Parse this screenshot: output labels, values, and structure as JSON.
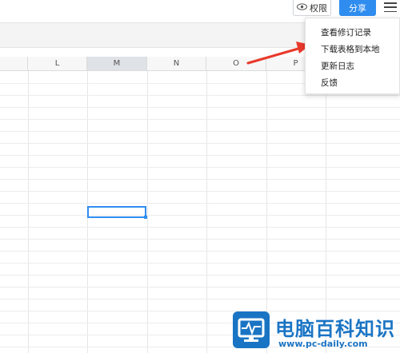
{
  "header": {
    "permissions_label": "权限",
    "share_label": "分享"
  },
  "columns": [
    {
      "label": "L",
      "selected": false
    },
    {
      "label": "M",
      "selected": true
    },
    {
      "label": "N",
      "selected": false
    },
    {
      "label": "O",
      "selected": false
    },
    {
      "label": "P",
      "selected": false
    }
  ],
  "dropdown_menu": {
    "items": [
      {
        "label": "查看修订记录"
      },
      {
        "label": "下载表格到本地"
      },
      {
        "label": "更新日志"
      },
      {
        "label": "反馈"
      }
    ]
  },
  "watermark": {
    "title": "电脑百科知识",
    "url": "www.pc-daily.com"
  },
  "colors": {
    "accent": "#2f8df0",
    "arrow": "#e8392b",
    "watermark": "#1a74c4"
  }
}
